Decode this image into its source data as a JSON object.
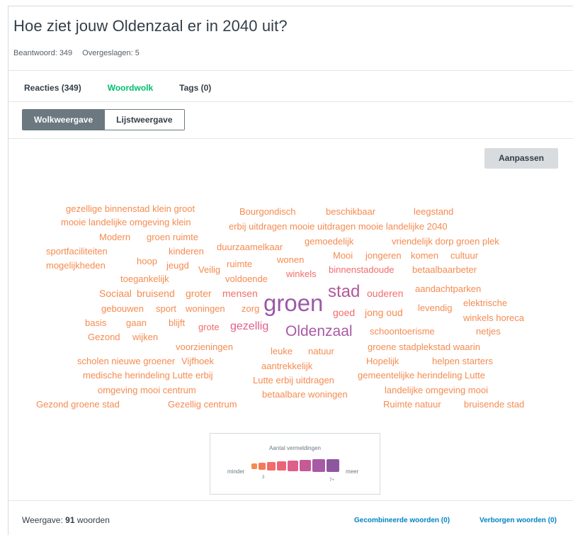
{
  "question": {
    "title": "Hoe ziet jouw Oldenzaal er in 2040 uit?",
    "answered": "Beantwoord: 349",
    "skipped": "Overgeslagen: 5"
  },
  "tabs": [
    "Reacties (349)",
    "Woordwolk",
    "Tags (0)"
  ],
  "active_tab": "Woordwolk",
  "view_toggle": {
    "cloud": "Wolkweergave",
    "list": "Lijstweergave",
    "active": "Wolkweergave"
  },
  "customize_label": "Aanpassen",
  "colors": {
    "accent_green": "#00bf6f",
    "link_blue": "#0083c1",
    "orange": "#f58b50",
    "coral": "#f26c6c",
    "pink": "#d35f9a",
    "purple": "#9b59a8"
  },
  "word_cloud": [
    {
      "text": "gezellige binnenstad klein groot",
      "color": "#f58b50"
    },
    {
      "text": "Bourgondisch",
      "color": "#f58b50"
    },
    {
      "text": "beschikbaar",
      "color": "#f58b50"
    },
    {
      "text": "leegstand",
      "color": "#f58b50"
    },
    {
      "text": "mooie landelijke omgeving klein",
      "color": "#f58b50"
    },
    {
      "text": "erbij uitdragen mooie uitdragen mooie landelijke 2040",
      "color": "#f58b50"
    },
    {
      "text": "Modern",
      "color": "#f58b50"
    },
    {
      "text": "groen ruimte",
      "color": "#f58b50"
    },
    {
      "text": "gemoedelijk",
      "color": "#f58b50"
    },
    {
      "text": "vriendelijk dorp groen plek",
      "color": "#f58b50"
    },
    {
      "text": "sportfaciliteiten",
      "color": "#f58b50"
    },
    {
      "text": "kinderen",
      "color": "#f58b50"
    },
    {
      "text": "duurzaamelkaar",
      "color": "#f58b50"
    },
    {
      "text": "Mooi",
      "color": "#f58b50"
    },
    {
      "text": "jongeren",
      "color": "#f58b50"
    },
    {
      "text": "komen",
      "color": "#f58b50"
    },
    {
      "text": "cultuur",
      "color": "#f58b50"
    },
    {
      "text": "mogelijkheden",
      "color": "#f58b50"
    },
    {
      "text": "hoop",
      "color": "#f58b50"
    },
    {
      "text": "jeugd",
      "color": "#f58b50"
    },
    {
      "text": "Veilig",
      "color": "#f58b50"
    },
    {
      "text": "ruimte",
      "color": "#f58b50"
    },
    {
      "text": "wonen",
      "color": "#f58b50"
    },
    {
      "text": "binnenstadoude",
      "color": "#f26c6c"
    },
    {
      "text": "betaalbaarbeter",
      "color": "#f58b50"
    },
    {
      "text": "toegankelijk",
      "color": "#f58b50"
    },
    {
      "text": "voldoende",
      "color": "#f58b50"
    },
    {
      "text": "winkels",
      "color": "#f26c6c"
    },
    {
      "text": "Sociaal",
      "color": "#f58b50"
    },
    {
      "text": "bruisend",
      "color": "#f58b50"
    },
    {
      "text": "groter",
      "color": "#f58b50"
    },
    {
      "text": "mensen",
      "color": "#f26c6c"
    },
    {
      "text": "stad",
      "color": "#b3589a"
    },
    {
      "text": "ouderen",
      "color": "#f26c6c"
    },
    {
      "text": "aandachtparken",
      "color": "#f58b50"
    },
    {
      "text": "gebouwen",
      "color": "#f58b50"
    },
    {
      "text": "sport",
      "color": "#f58b50"
    },
    {
      "text": "woningen",
      "color": "#f58b50"
    },
    {
      "text": "zorg",
      "color": "#f58b50"
    },
    {
      "text": "groen",
      "color": "#9b59a8"
    },
    {
      "text": "goed",
      "color": "#f26c6c"
    },
    {
      "text": "jong oud",
      "color": "#f58b50"
    },
    {
      "text": "levendig",
      "color": "#f58b50"
    },
    {
      "text": "elektrische",
      "color": "#f58b50"
    },
    {
      "text": "winkels horeca",
      "color": "#f58b50"
    },
    {
      "text": "basis",
      "color": "#f58b50"
    },
    {
      "text": "gaan",
      "color": "#f58b50"
    },
    {
      "text": "blijft",
      "color": "#f58b50"
    },
    {
      "text": "grote",
      "color": "#f26c6c"
    },
    {
      "text": "gezellig",
      "color": "#e0608a"
    },
    {
      "text": "Oldenzaal",
      "color": "#a85aa4"
    },
    {
      "text": "schoontoerisme",
      "color": "#f58b50"
    },
    {
      "text": "netjes",
      "color": "#f58b50"
    },
    {
      "text": "Gezond",
      "color": "#f58b50"
    },
    {
      "text": "wijken",
      "color": "#f58b50"
    },
    {
      "text": "voorzieningen",
      "color": "#f58b50"
    },
    {
      "text": "leuke",
      "color": "#f58b50"
    },
    {
      "text": "natuur",
      "color": "#f58b50"
    },
    {
      "text": "groene stadplekstad waarin",
      "color": "#f58b50"
    },
    {
      "text": "scholen nieuwe groener",
      "color": "#f58b50"
    },
    {
      "text": "Vijfhoek",
      "color": "#f58b50"
    },
    {
      "text": "Hopelijk",
      "color": "#f58b50"
    },
    {
      "text": "helpen starters",
      "color": "#f58b50"
    },
    {
      "text": "aantrekkelijk",
      "color": "#f58b50"
    },
    {
      "text": "medische herindeling Lutte erbij",
      "color": "#f58b50"
    },
    {
      "text": "Lutte erbij uitdragen",
      "color": "#f58b50"
    },
    {
      "text": "gemeentelijke herindeling Lutte",
      "color": "#f58b50"
    },
    {
      "text": "omgeving mooi centrum",
      "color": "#f58b50"
    },
    {
      "text": "landelijke omgeving mooi",
      "color": "#f58b50"
    },
    {
      "text": "betaalbare woningen",
      "color": "#f58b50"
    },
    {
      "text": "Gezond groene stad",
      "color": "#f58b50"
    },
    {
      "text": "Gezellig centrum",
      "color": "#f58b50"
    },
    {
      "text": "Ruimte natuur",
      "color": "#f58b50"
    },
    {
      "text": "bruisende stad",
      "color": "#f58b50"
    }
  ],
  "legend": {
    "title": "Aantal vermeldingen",
    "min_label": "minder",
    "max_label": "meer",
    "min_tick": "3",
    "max_tick": "7+",
    "swatches": [
      "#f58b50",
      "#f47a5a",
      "#f26c6c",
      "#ea6478",
      "#de5f8a",
      "#c55a97",
      "#a85aa4",
      "#8f56a0"
    ]
  },
  "footer": {
    "display_prefix": "Weergave: ",
    "display_count": "91",
    "display_suffix": " woorden",
    "combined_words": "Gecombineerde woorden (0)",
    "hidden_words": "Verborgen woorden (0)"
  }
}
